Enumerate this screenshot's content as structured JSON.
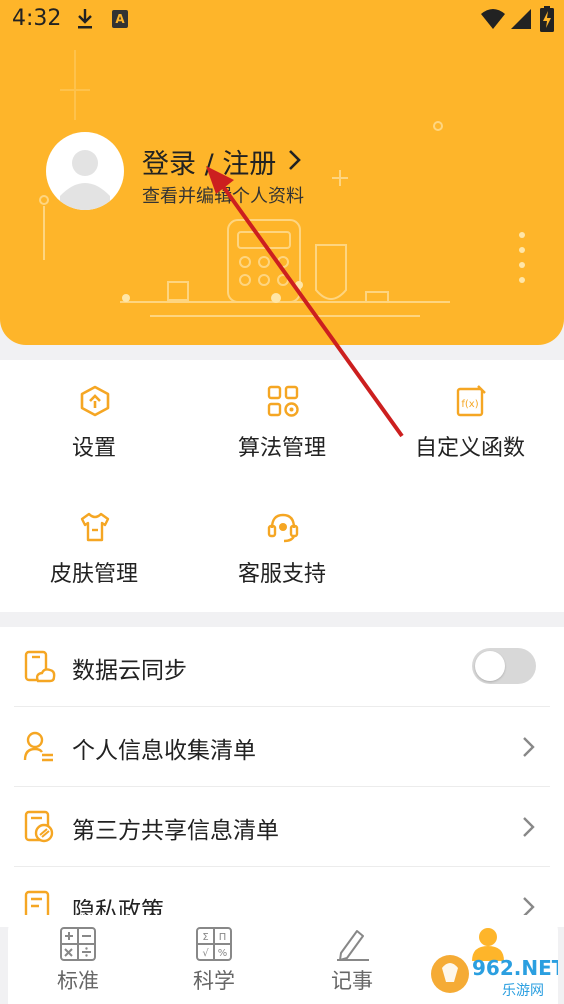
{
  "status_bar": {
    "time": "4:32",
    "a_badge": "A"
  },
  "profile": {
    "title": "登录 / 注册",
    "subtitle": "查看并编辑个人资料"
  },
  "grid": [
    {
      "label": "设置",
      "icon": "gear-hex-icon"
    },
    {
      "label": "算法管理",
      "icon": "apps-icon"
    },
    {
      "label": "自定义函数",
      "icon": "function-icon"
    },
    {
      "label": "皮肤管理",
      "icon": "shirt-icon"
    },
    {
      "label": "客服支持",
      "icon": "headset-icon"
    }
  ],
  "list": [
    {
      "label": "数据云同步",
      "icon": "cloud-sync-icon",
      "control": "toggle",
      "toggle_on": false
    },
    {
      "label": "个人信息收集清单",
      "icon": "person-list-icon",
      "control": "chevron"
    },
    {
      "label": "第三方共享信息清单",
      "icon": "share-list-icon",
      "control": "chevron"
    },
    {
      "label": "隐私政策",
      "icon": "document-icon",
      "control": "chevron"
    }
  ],
  "bottom_nav": [
    {
      "label": "标准",
      "icon": "calculator-basic-icon"
    },
    {
      "label": "科学",
      "icon": "calculator-scientific-icon"
    },
    {
      "label": "记事",
      "icon": "notes-icon"
    },
    {
      "label": "",
      "icon": "profile-icon"
    }
  ],
  "colors": {
    "accent": "#feb52a",
    "arrow": "#cc1f1f"
  },
  "watermark": {
    "big": "962.NET",
    "small": "乐游网"
  }
}
